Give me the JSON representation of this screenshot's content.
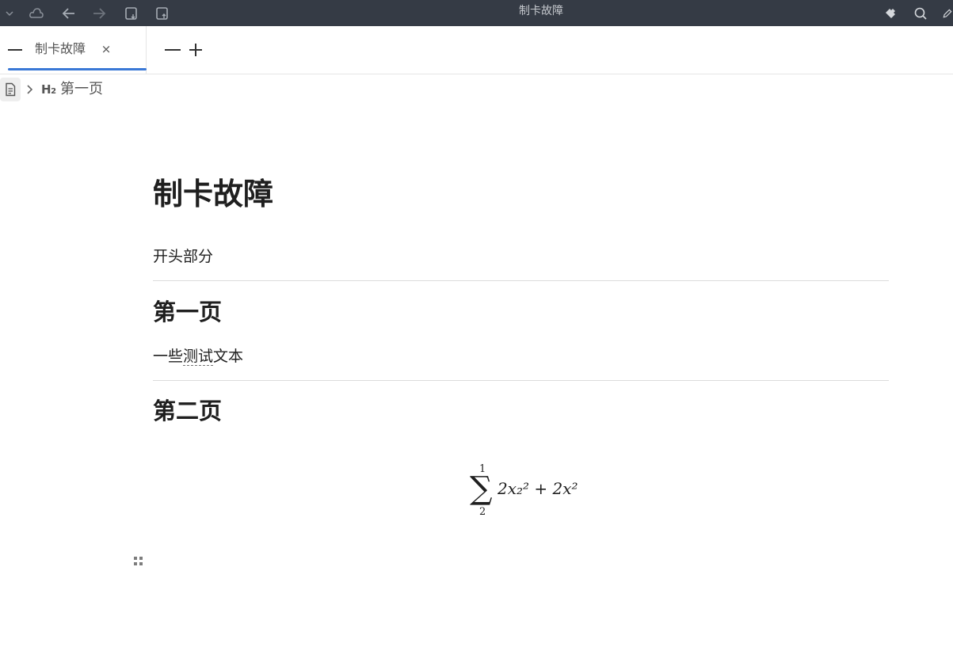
{
  "window": {
    "title": "制卡故障"
  },
  "toolbar": {
    "icons": [
      "chevron-down-icon",
      "cloud-icon",
      "back-arrow-icon",
      "forward-arrow-icon",
      "tablet-download-icon",
      "tablet-upload-icon"
    ],
    "right_icons": [
      "plugin-icon",
      "search-icon",
      "edit-icon"
    ]
  },
  "tabs": {
    "active_label": "制卡故障",
    "close_glyph": "×"
  },
  "breadcrumb": {
    "heading_marker": "H",
    "heading_level": "2",
    "label": "第一页"
  },
  "document": {
    "title": "制卡故障",
    "intro": "开头部分",
    "sections": [
      {
        "heading": "第一页",
        "text_before": "一些",
        "text_underlined": "测试",
        "text_after": "文本"
      },
      {
        "heading": "第二页"
      }
    ],
    "formula": {
      "upper": "1",
      "lower": "2",
      "body": "2x₂² + 2x²"
    }
  }
}
